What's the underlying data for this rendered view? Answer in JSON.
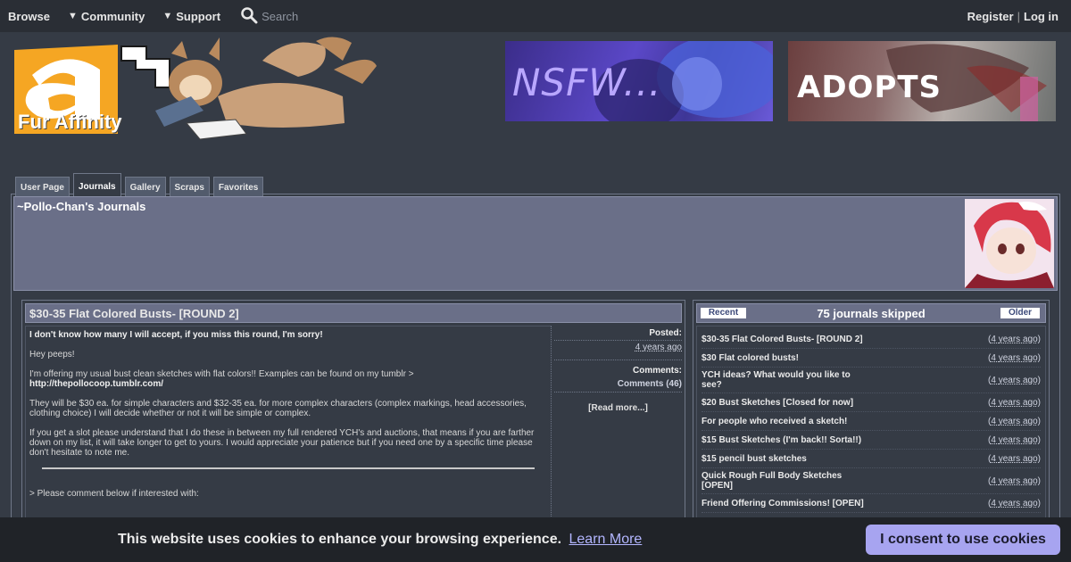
{
  "nav": {
    "browse": "Browse",
    "community": "Community",
    "support": "Support",
    "search_placeholder": "Search",
    "register": "Register",
    "separator": "|",
    "login": "Log in"
  },
  "logo": {
    "text": "Fur Affinity"
  },
  "ads": [
    {
      "text": "NSFW..."
    },
    {
      "text": "ADOPTS"
    }
  ],
  "tabs": [
    "User Page",
    "Journals",
    "Gallery",
    "Scraps",
    "Favorites"
  ],
  "active_tab": "Journals",
  "header": {
    "title": "~Pollo-Chan's Journals"
  },
  "journal": {
    "title": "$30-35 Flat Colored Busts- [ROUND 2]",
    "lines": {
      "intro": "I don't know how many I will accept, if you miss this round, I'm sorry!",
      "greeting": "Hey peeps!",
      "offer": "I'm offering my usual bust clean sketches with flat colors!! Examples can be found on my tumblr >",
      "link": "http://thepollocoop.tumblr.com/",
      "price": "They will be $30 ea. for simple characters and $32-35 ea. for more complex characters (complex markings, head accessories, clothing choice) I will decide whether or not it will be simple or complex.",
      "slot": "If you get a slot please understand that I do these in between my full rendered YCH's and auctions, that means if you are farther down on my list, it will take longer to get to yours. I would appreciate your patience but if you need one by a specific time please don't hesitate to note me.",
      "comment": "> Please comment below if interested with:"
    },
    "meta": {
      "posted_label": "Posted:",
      "posted_value": "4 years ago",
      "comments_label": "Comments:",
      "comments_value": "Comments (46)",
      "read_more": "[Read more...]"
    }
  },
  "sidebar": {
    "recent": "Recent",
    "skipped": "75 journals skipped",
    "older": "Older",
    "items": [
      {
        "title": "$30-35 Flat Colored Busts- [ROUND 2]",
        "age": "4 years ago"
      },
      {
        "title": "$30 Flat colored busts!",
        "age": "4 years ago"
      },
      {
        "title": "YCH ideas? What would you like to see?",
        "age": "4 years ago"
      },
      {
        "title": "$20 Bust Sketches [Closed for now]",
        "age": "4 years ago"
      },
      {
        "title": "For people who received a sketch!",
        "age": "4 years ago"
      },
      {
        "title": "$15 Bust Sketches (I'm back!! Sorta!!)",
        "age": "4 years ago"
      },
      {
        "title": "$15 pencil bust sketches",
        "age": "4 years ago"
      },
      {
        "title": "Quick Rough Full Body Sketches [OPEN]",
        "age": "4 years ago"
      },
      {
        "title": "Friend Offering Commissions! [OPEN]",
        "age": "4 years ago"
      }
    ]
  },
  "cookie": {
    "text": "This website uses cookies to enhance your browsing experience.",
    "learn_more": "Learn More",
    "consent": "I consent to use cookies"
  },
  "colors": {
    "page_bg": "#353b45",
    "nav_bg": "#2a2e35",
    "panel": "#6a6f88",
    "tab": "#525b6c",
    "logo_orange": "#f5a623",
    "cookie_button": "#a7a4f0"
  }
}
